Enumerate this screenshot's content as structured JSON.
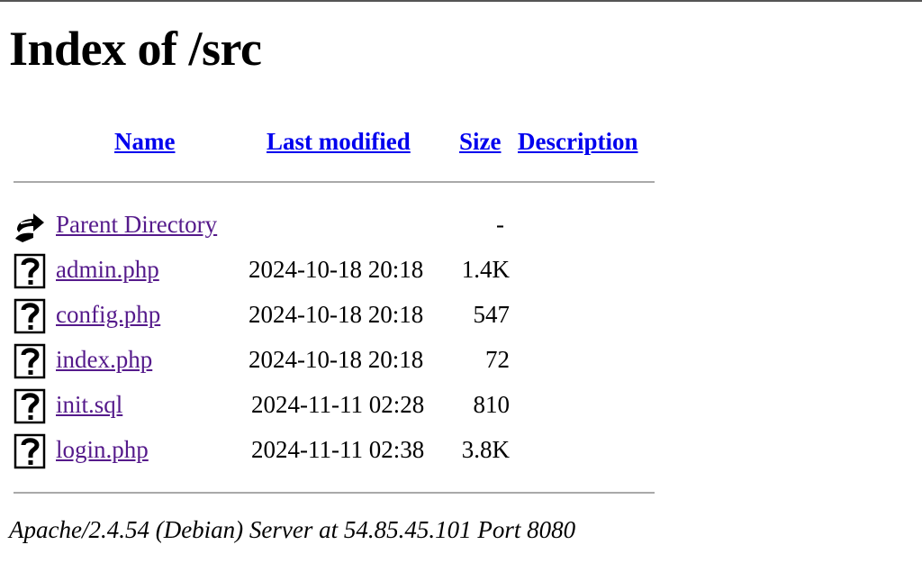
{
  "page": {
    "title": "Index of /src"
  },
  "table": {
    "headers": {
      "name": "Name",
      "last_modified": "Last modified",
      "size": "Size",
      "description": "Description"
    },
    "parent": {
      "label": "Parent Directory",
      "size": "-",
      "icon": "back-arrow-icon"
    },
    "rows": [
      {
        "name": "admin.php",
        "date": "2024-10-18 20:18",
        "size": "1.4K",
        "icon": "unknown-file-icon"
      },
      {
        "name": "config.php",
        "date": "2024-10-18 20:18",
        "size": "547",
        "icon": "unknown-file-icon"
      },
      {
        "name": "index.php",
        "date": "2024-10-18 20:18",
        "size": "72",
        "icon": "unknown-file-icon"
      },
      {
        "name": "init.sql",
        "date": "2024-11-11 02:28",
        "size": "810",
        "icon": "unknown-file-icon"
      },
      {
        "name": "login.php",
        "date": "2024-11-11 02:38",
        "size": "3.8K",
        "icon": "unknown-file-icon"
      }
    ]
  },
  "footer": {
    "text": "Apache/2.4.54 (Debian) Server at 54.85.45.101 Port 8080"
  },
  "colors": {
    "link": "#0000ee",
    "visited_link": "#551a8b",
    "rule": "#a9a9a9"
  }
}
